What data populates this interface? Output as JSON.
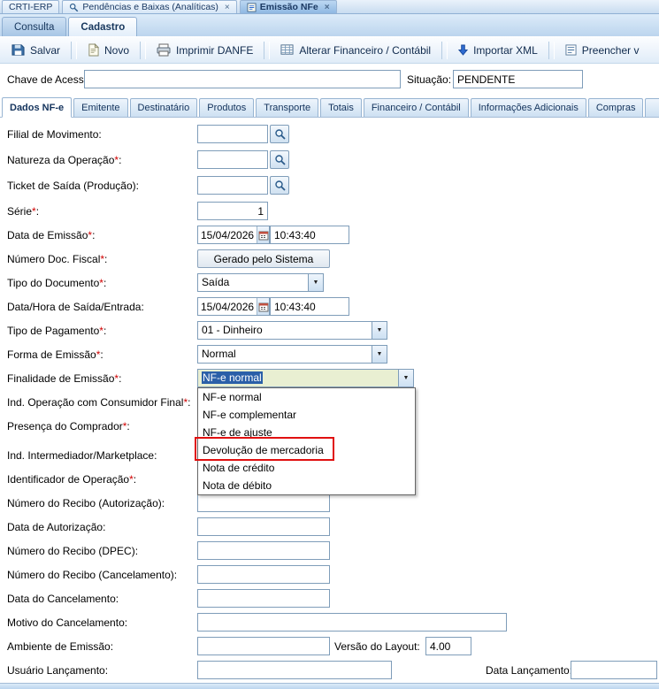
{
  "window_tabs": {
    "tab1": "CRTI-ERP",
    "tab2": "Pendências e Baixas (Analíticas)",
    "tab3": "Emissão NFe",
    "close_glyph": "×"
  },
  "view_tabs": {
    "consulta": "Consulta",
    "cadastro": "Cadastro"
  },
  "toolbar": {
    "salvar": "Salvar",
    "novo": "Novo",
    "imprimir_danfe": "Imprimir DANFE",
    "alterar_financeiro": "Alterar Financeiro / Contábil",
    "importar_xml": "Importar XML",
    "preencher": "Preencher v"
  },
  "header": {
    "chave_label": "Chave de Acesso:",
    "chave_value": "",
    "situacao_label": "Situação:",
    "situacao_value": "PENDENTE"
  },
  "section_tabs": [
    "Dados NF-e",
    "Emitente",
    "Destinatário",
    "Produtos",
    "Transporte",
    "Totais",
    "Financeiro / Contábil",
    "Informações Adicionais",
    "Compras"
  ],
  "form": {
    "filial": {
      "label": "Filial de Movimento",
      "star": "",
      "colon": ":",
      "value": ""
    },
    "natureza": {
      "label": "Natureza da Operação",
      "star": "*",
      "colon": ":",
      "value": ""
    },
    "ticket": {
      "label": "Ticket de Saída (Produção)",
      "star": "",
      "colon": ":",
      "value": ""
    },
    "serie": {
      "label": "Série",
      "star": "*",
      "colon": ":",
      "value": "1"
    },
    "data_emissao": {
      "label": "Data de Emissão",
      "star": "*",
      "colon": ":",
      "date": "15/04/2026",
      "time": "10:43:40"
    },
    "numero_doc": {
      "label": "Número Doc. Fiscal",
      "star": "*",
      "colon": ":",
      "value": "Gerado pelo Sistema"
    },
    "tipo_documento": {
      "label": "Tipo do Documento",
      "star": "*",
      "colon": ":",
      "value": "Saída"
    },
    "data_saida": {
      "label": "Data/Hora de Saída/Entrada",
      "star": "",
      "colon": ":",
      "date": "15/04/2026",
      "time": "10:43:40"
    },
    "tipo_pagamento": {
      "label": "Tipo de Pagamento",
      "star": "*",
      "colon": ":",
      "value": "01 - Dinheiro"
    },
    "forma_emissao": {
      "label": "Forma de Emissão",
      "star": "*",
      "colon": ":",
      "value": "Normal"
    },
    "finalidade": {
      "label": "Finalidade de Emissão",
      "star": "*",
      "colon": ":",
      "value": "NF-e normal"
    },
    "ind_consumidor": {
      "label": "Ind. Operação com Consumidor Final",
      "star": "*",
      "colon": ":"
    },
    "presenca": {
      "label": "Presença do Comprador",
      "star": "*",
      "colon": ":"
    },
    "intermediador": {
      "label": "Ind. Intermediador/Marketplace",
      "star": "",
      "colon": ":"
    },
    "identificador": {
      "label": "Identificador de Operação",
      "star": "*",
      "colon": ":"
    },
    "recibo_autorizacao": {
      "label": "Número do Recibo (Autorização)",
      "star": "",
      "colon": ":",
      "value": ""
    },
    "data_autorizacao": {
      "label": "Data de Autorização",
      "star": "",
      "colon": ":",
      "value": ""
    },
    "recibo_dpec": {
      "label": "Número do Recibo (DPEC)",
      "star": "",
      "colon": ":",
      "value": ""
    },
    "recibo_cancelamento": {
      "label": "Número do Recibo (Cancelamento)",
      "star": "",
      "colon": ":",
      "value": ""
    },
    "data_cancelamento": {
      "label": "Data do Cancelamento",
      "star": "",
      "colon": ":",
      "value": ""
    },
    "motivo_cancelamento": {
      "label": "Motivo do Cancelamento",
      "star": "",
      "colon": ":",
      "value": ""
    },
    "ambiente": {
      "label": "Ambiente de Emissão",
      "star": "",
      "colon": ":",
      "value": ""
    },
    "versao_layout": {
      "label": "Versão do Layout",
      "star": "",
      "colon": ":",
      "value": "4.00"
    },
    "usuario": {
      "label": "Usuário Lançamento",
      "star": "",
      "colon": ":",
      "value": ""
    },
    "data_lancamento": {
      "label": "Data Lançamento",
      "star": "",
      "colon": ":",
      "value": ""
    }
  },
  "dropdown": {
    "items": [
      "NF-e normal",
      "NF-e complementar",
      "NF-e de ajuste",
      "Devolução de mercadoria",
      "Nota de crédito",
      "Nota de débito"
    ],
    "highlighted": "Devolução de mercadoria"
  },
  "colors": {
    "highlight_box": "#e01010",
    "selection": "#2b5fa8",
    "required": "#d00000",
    "finalidade_field_bg": "#e9efd2"
  }
}
